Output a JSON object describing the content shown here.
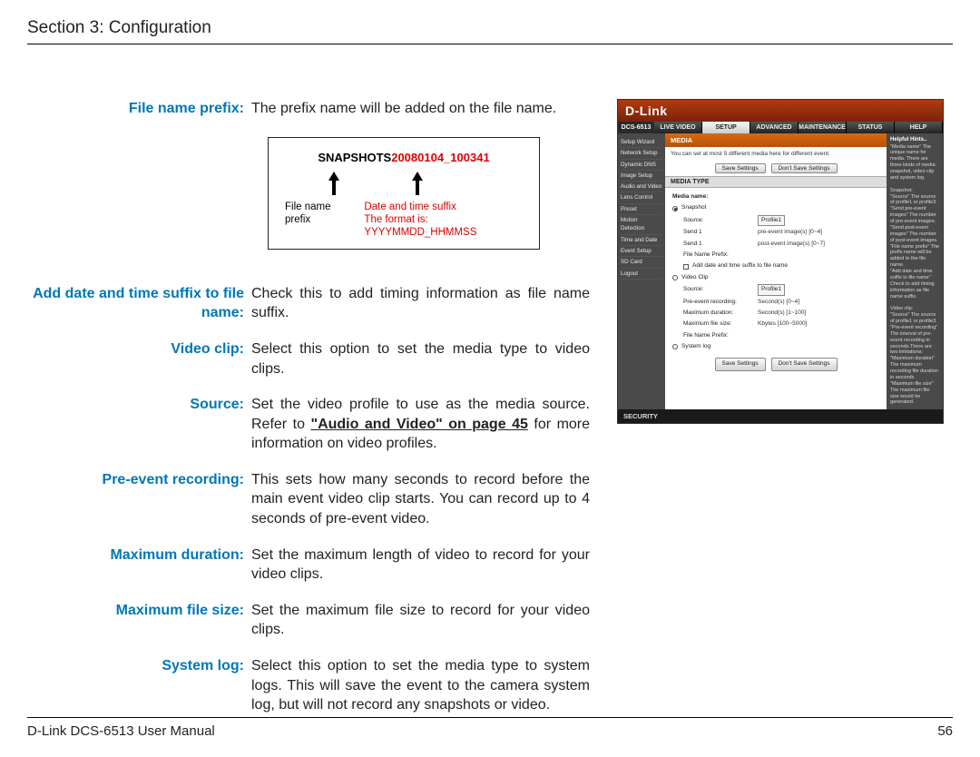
{
  "header": {
    "section_title": "Section 3: Configuration"
  },
  "defs": {
    "file_name_prefix": {
      "label": "File name prefix:",
      "text": "The prefix name will be added on the file name."
    },
    "snapshot_box": {
      "title_black": "SNAPSHOTS",
      "title_red": "20080104_100341",
      "caption_left": "File name prefix",
      "caption_right_line1": "Date and time suffix",
      "caption_right_line2": "The format is: YYYYMMDD_HHMMSS"
    },
    "add_suffix": {
      "label": "Add date and time suffix to file name:",
      "text": "Check this to add timing information as file name suffix."
    },
    "video_clip": {
      "label": "Video clip:",
      "text": "Select this option to set the media type to video clips."
    },
    "source": {
      "label": "Source:",
      "text_before": "Set the video profile to use as the media source. Refer to ",
      "link": "\"Audio and Video\" on page 45",
      "text_after": " for more information on video profiles."
    },
    "pre_event": {
      "label": "Pre-event recording:",
      "text": "This sets how many seconds to record before the main event video clip starts. You can record up to 4 seconds of pre-event video."
    },
    "max_duration": {
      "label": "Maximum duration:",
      "text": "Set the maximum length of video to record for your video clips."
    },
    "max_size": {
      "label": "Maximum file size:",
      "text": "Set the maximum file size to record for your video clips."
    },
    "system_log": {
      "label": "System log:",
      "text": "Select this option to set the media type to system logs. This will save the event to the camera system log, but will not record any snapshots or video."
    }
  },
  "mini": {
    "brand": "D-Link",
    "model": "DCS-6513",
    "tabs": [
      "LIVE VIDEO",
      "SETUP",
      "ADVANCED",
      "MAINTENANCE",
      "STATUS",
      "HELP"
    ],
    "side": [
      "Setup Wizard",
      "Network Setup",
      "Dynamic DNS",
      "Image Setup",
      "Audio and Video",
      "Lens Control",
      "Preset",
      "Motion Detection",
      "Time and Date",
      "Event Setup",
      "SD Card",
      "Logout"
    ],
    "panel_title": "MEDIA",
    "note": "You can set at most 5 different media here for different event.",
    "save": "Save Settings",
    "dont_save": "Don't Save Settings",
    "media_type": "MEDIA TYPE",
    "media_name": "Media name:",
    "snapshot": "Snapshot",
    "source": "Source:",
    "profile": "Profile1",
    "send1": "Send 1",
    "send1_val": "pre-event image(s) [0~4]",
    "send2": "Send 1",
    "send2_val": "post-event image(s) [0~7]",
    "fnp": "File Name Prefix:",
    "addsfx": "Add date and time suffix to file name",
    "videoclip": "Video Clip",
    "per": "Pre-event recording:",
    "per_val": "Second(s) [0~4]",
    "md": "Maximum duration:",
    "md_val": "Second(s) [1~100]",
    "mfs": "Maximum file size:",
    "mfs_val": "Kbytes [100~5000]",
    "syslog": "System log",
    "help_title": "Helpful Hints..",
    "help_body": "\"Media name\" The unique name for media. There are three kinds of media: snapshot, video clip and system log.\n\nSnapshot:\n\"Source\" The source of profile1 or profile3.\n\"Send pre-event images\" The number of pre-event images.\n\"Send post-event images\" The number of post-event images.\n\"File name prefix\" The prefix name will be added to the file name.\n\"Add date and time suffix to file name\" Check to add timing information as file name suffix.\n\nVideo clip:\n\"Source\" The source of profile1 or profile3.\n\"Pre-event recording\" The interval of pre-event recording in seconds.There are two limitations:\n\"Maximum duration\" The maximum recording file duration in seconds.\n\"Maximum file size\" The maximum file size would be generated.",
    "footer": "SECURITY"
  },
  "footer": {
    "manual": "D-Link DCS-6513 User Manual",
    "page": "56"
  }
}
